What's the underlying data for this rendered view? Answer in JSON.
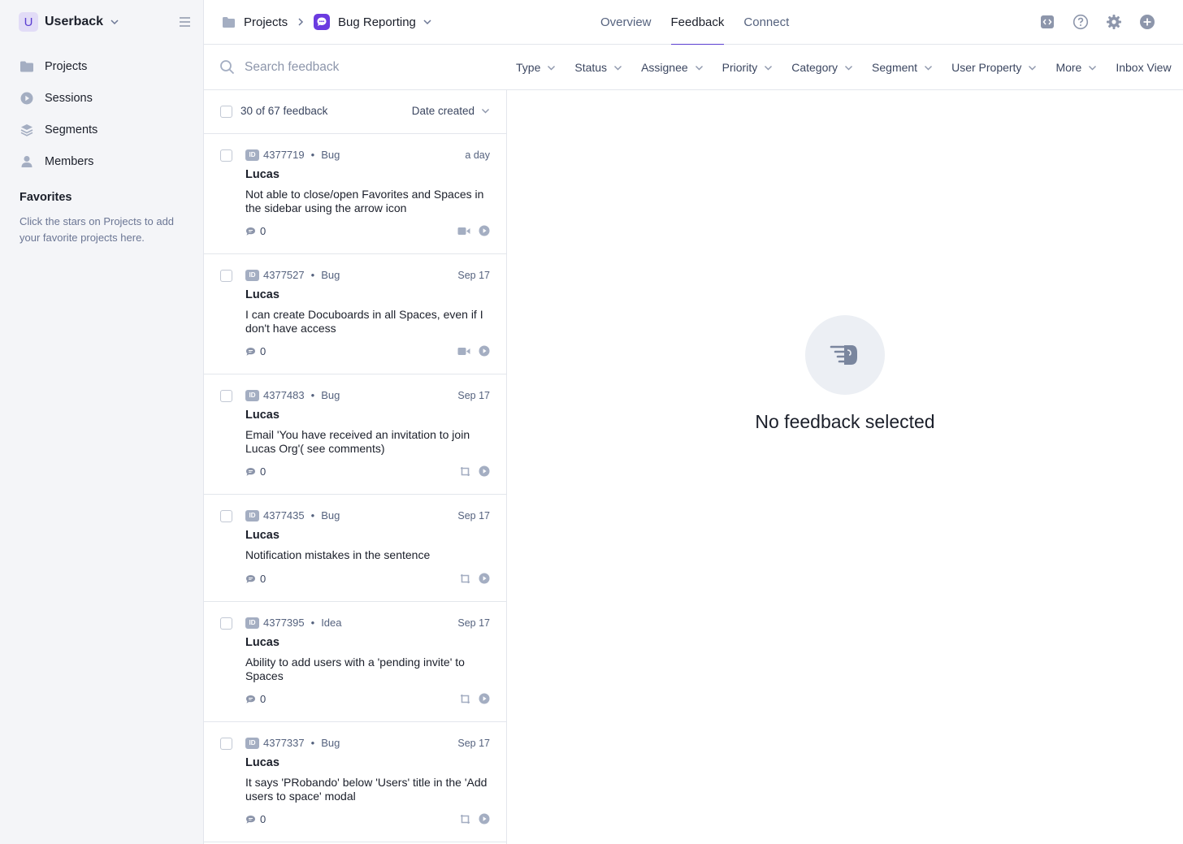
{
  "sidebar": {
    "workspace_initial": "U",
    "workspace_name": "Userback",
    "items": [
      {
        "label": "Projects",
        "icon": "folder-icon"
      },
      {
        "label": "Sessions",
        "icon": "play-circle-icon"
      },
      {
        "label": "Segments",
        "icon": "layers-icon"
      },
      {
        "label": "Members",
        "icon": "user-icon"
      }
    ],
    "favorites_title": "Favorites",
    "favorites_hint": "Click the stars on Projects to add your favorite projects here."
  },
  "header": {
    "breadcrumb_root": "Projects",
    "project_name": "Bug Reporting",
    "tabs": [
      {
        "label": "Overview",
        "active": false
      },
      {
        "label": "Feedback",
        "active": true
      },
      {
        "label": "Connect",
        "active": false
      }
    ],
    "icons": [
      "code-icon",
      "help-icon",
      "gear-icon",
      "plus-circle-icon"
    ]
  },
  "filters": {
    "search_placeholder": "Search feedback",
    "items": [
      "Type",
      "Status",
      "Assignee",
      "Priority",
      "Category",
      "Segment",
      "User Property",
      "More",
      "Inbox View"
    ]
  },
  "list": {
    "count_label": "30 of 67 feedback",
    "sort_label": "Date created",
    "items": [
      {
        "id": "4377719",
        "type": "Bug",
        "time": "a day",
        "author": "Lucas",
        "text": "Not able to close/open Favorites and Spaces in the sidebar using the arrow icon",
        "comments": "0",
        "attachment": "video-icon"
      },
      {
        "id": "4377527",
        "type": "Bug",
        "time": "Sep 17",
        "author": "Lucas",
        "text": "I can create Docuboards in all Spaces, even if I don't have access",
        "comments": "0",
        "attachment": "video-icon"
      },
      {
        "id": "4377483",
        "type": "Bug",
        "time": "Sep 17",
        "author": "Lucas",
        "text": "Email 'You have received an invitation to join Lucas Org'( see comments)",
        "comments": "0",
        "attachment": "screenshot-icon"
      },
      {
        "id": "4377435",
        "type": "Bug",
        "time": "Sep 17",
        "author": "Lucas",
        "text": "Notification mistakes in the sentence",
        "comments": "0",
        "attachment": "screenshot-icon"
      },
      {
        "id": "4377395",
        "type": "Idea",
        "time": "Sep 17",
        "author": "Lucas",
        "text": "Ability to add users with a 'pending invite' to Spaces",
        "comments": "0",
        "attachment": "screenshot-icon"
      },
      {
        "id": "4377337",
        "type": "Bug",
        "time": "Sep 17",
        "author": "Lucas",
        "text": "It says 'PRobando' below 'Users' title in the 'Add users to space' modal",
        "comments": "0",
        "attachment": "screenshot-icon"
      }
    ]
  },
  "detail": {
    "empty_text": "No feedback selected",
    "empty_icon": "pointing-hand-icon"
  },
  "colors": {
    "accent": "#5b3fd1",
    "sidebar_bg": "#f4f5f8",
    "border": "#e3e6ec",
    "muted_text": "#55627e"
  }
}
